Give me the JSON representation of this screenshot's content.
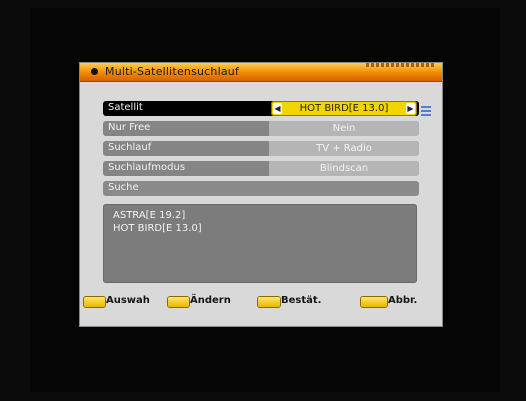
{
  "menu": {
    "title": "Multi-Satellitensuchlauf"
  },
  "rows": [
    {
      "label": "Satellit",
      "value": "HOT BIRD[E 13.0]"
    },
    {
      "label": "Nur Free",
      "value": "Nein"
    },
    {
      "label": "Suchlauf",
      "value": "TV + Radio"
    },
    {
      "label": "Suchlaufmodus",
      "value": "Blindscan"
    },
    {
      "label": "Suche",
      "value": ""
    }
  ],
  "info": {
    "lines": [
      "ASTRA[E 19.2]",
      "HOT BIRD[E 13.0]"
    ]
  },
  "footer": {
    "hints": [
      {
        "label": "Auswah",
        "key_color": "#f2d400"
      },
      {
        "label": "Ändern",
        "key_color": "#f2d400"
      },
      {
        "label": "Bestät.",
        "key_color": "#f2d400"
      },
      {
        "label": "Abbr.",
        "key_color": "#f2d400"
      }
    ]
  },
  "colors": {
    "title_bar": "#f08a00",
    "selected_value": "#f2d400",
    "panel": "#d9d9d9"
  }
}
